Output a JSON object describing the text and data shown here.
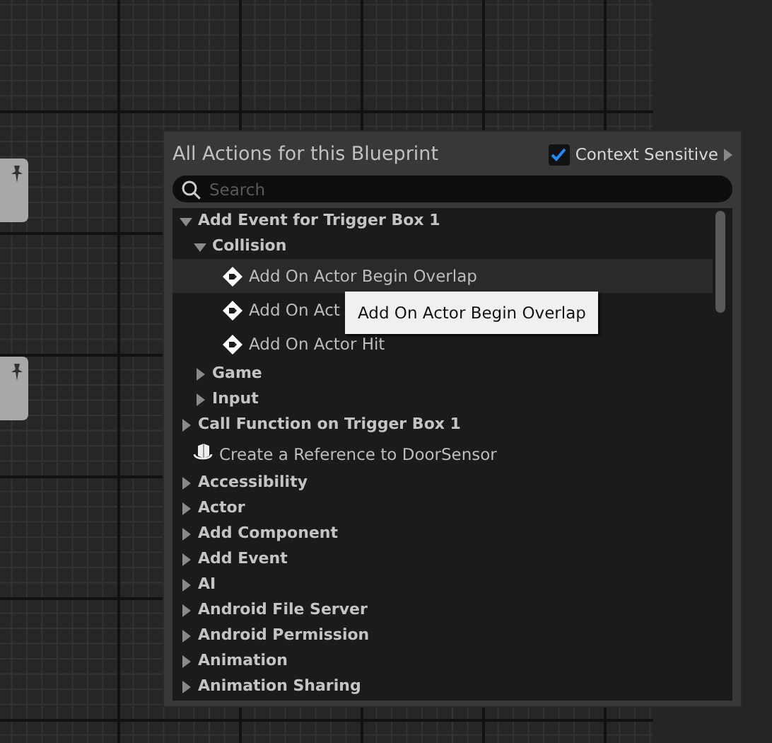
{
  "menu": {
    "title": "All Actions for this Blueprint",
    "context_sensitive": {
      "label": "Context Sensitive",
      "checked": true
    },
    "search": {
      "placeholder": "Search"
    },
    "items": [
      {
        "kind": "category",
        "label": "Add Event for Trigger Box 1",
        "expanded": true,
        "children": [
          {
            "kind": "category",
            "label": "Collision",
            "expanded": true,
            "children": [
              {
                "kind": "event",
                "label": "Add On Actor Begin Overlap",
                "hovered": true
              },
              {
                "kind": "event",
                "label": "Add On Act",
                "hovered": false
              },
              {
                "kind": "event",
                "label": "Add On Actor Hit",
                "hovered": false
              }
            ]
          },
          {
            "kind": "category",
            "label": "Game",
            "expanded": false
          },
          {
            "kind": "category",
            "label": "Input",
            "expanded": false
          }
        ]
      },
      {
        "kind": "category",
        "label": "Call Function on Trigger Box 1",
        "expanded": false
      },
      {
        "kind": "reference",
        "label": "Create a Reference to DoorSensor"
      },
      {
        "kind": "category",
        "label": "Accessibility",
        "expanded": false
      },
      {
        "kind": "category",
        "label": "Actor",
        "expanded": false
      },
      {
        "kind": "category",
        "label": "Add Component",
        "expanded": false
      },
      {
        "kind": "category",
        "label": "Add Event",
        "expanded": false
      },
      {
        "kind": "category",
        "label": "AI",
        "expanded": false
      },
      {
        "kind": "category",
        "label": "Android File Server",
        "expanded": false
      },
      {
        "kind": "category",
        "label": "Android Permission",
        "expanded": false
      },
      {
        "kind": "category",
        "label": "Animation",
        "expanded": false
      },
      {
        "kind": "category",
        "label": "Animation Sharing",
        "expanded": false
      }
    ],
    "tooltip": "Add On Actor Begin Overlap"
  }
}
